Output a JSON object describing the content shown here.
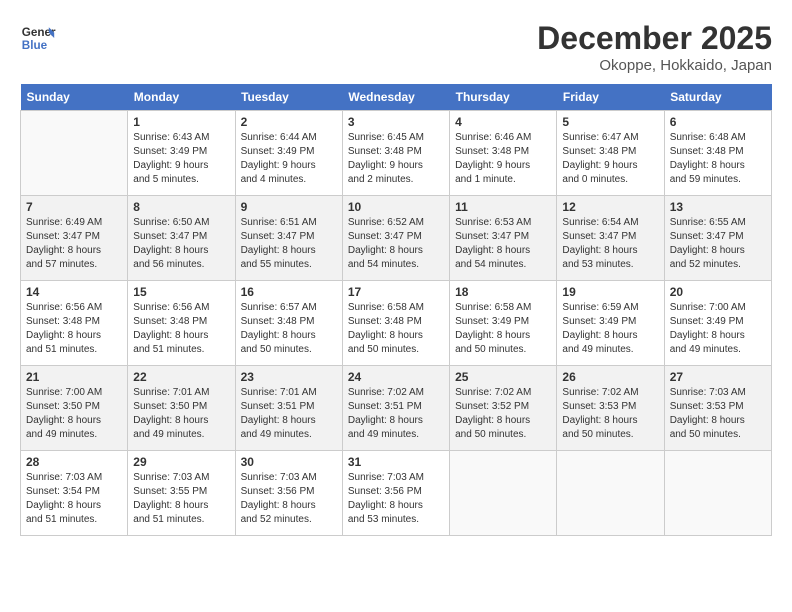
{
  "header": {
    "logo_line1": "General",
    "logo_line2": "Blue",
    "title": "December 2025",
    "subtitle": "Okoppe, Hokkaido, Japan"
  },
  "weekdays": [
    "Sunday",
    "Monday",
    "Tuesday",
    "Wednesday",
    "Thursday",
    "Friday",
    "Saturday"
  ],
  "weeks": [
    [
      {
        "day": "",
        "info": ""
      },
      {
        "day": "1",
        "info": "Sunrise: 6:43 AM\nSunset: 3:49 PM\nDaylight: 9 hours\nand 5 minutes."
      },
      {
        "day": "2",
        "info": "Sunrise: 6:44 AM\nSunset: 3:49 PM\nDaylight: 9 hours\nand 4 minutes."
      },
      {
        "day": "3",
        "info": "Sunrise: 6:45 AM\nSunset: 3:48 PM\nDaylight: 9 hours\nand 2 minutes."
      },
      {
        "day": "4",
        "info": "Sunrise: 6:46 AM\nSunset: 3:48 PM\nDaylight: 9 hours\nand 1 minute."
      },
      {
        "day": "5",
        "info": "Sunrise: 6:47 AM\nSunset: 3:48 PM\nDaylight: 9 hours\nand 0 minutes."
      },
      {
        "day": "6",
        "info": "Sunrise: 6:48 AM\nSunset: 3:48 PM\nDaylight: 8 hours\nand 59 minutes."
      }
    ],
    [
      {
        "day": "7",
        "info": "Sunrise: 6:49 AM\nSunset: 3:47 PM\nDaylight: 8 hours\nand 57 minutes."
      },
      {
        "day": "8",
        "info": "Sunrise: 6:50 AM\nSunset: 3:47 PM\nDaylight: 8 hours\nand 56 minutes."
      },
      {
        "day": "9",
        "info": "Sunrise: 6:51 AM\nSunset: 3:47 PM\nDaylight: 8 hours\nand 55 minutes."
      },
      {
        "day": "10",
        "info": "Sunrise: 6:52 AM\nSunset: 3:47 PM\nDaylight: 8 hours\nand 54 minutes."
      },
      {
        "day": "11",
        "info": "Sunrise: 6:53 AM\nSunset: 3:47 PM\nDaylight: 8 hours\nand 54 minutes."
      },
      {
        "day": "12",
        "info": "Sunrise: 6:54 AM\nSunset: 3:47 PM\nDaylight: 8 hours\nand 53 minutes."
      },
      {
        "day": "13",
        "info": "Sunrise: 6:55 AM\nSunset: 3:47 PM\nDaylight: 8 hours\nand 52 minutes."
      }
    ],
    [
      {
        "day": "14",
        "info": "Sunrise: 6:56 AM\nSunset: 3:48 PM\nDaylight: 8 hours\nand 51 minutes."
      },
      {
        "day": "15",
        "info": "Sunrise: 6:56 AM\nSunset: 3:48 PM\nDaylight: 8 hours\nand 51 minutes."
      },
      {
        "day": "16",
        "info": "Sunrise: 6:57 AM\nSunset: 3:48 PM\nDaylight: 8 hours\nand 50 minutes."
      },
      {
        "day": "17",
        "info": "Sunrise: 6:58 AM\nSunset: 3:48 PM\nDaylight: 8 hours\nand 50 minutes."
      },
      {
        "day": "18",
        "info": "Sunrise: 6:58 AM\nSunset: 3:49 PM\nDaylight: 8 hours\nand 50 minutes."
      },
      {
        "day": "19",
        "info": "Sunrise: 6:59 AM\nSunset: 3:49 PM\nDaylight: 8 hours\nand 49 minutes."
      },
      {
        "day": "20",
        "info": "Sunrise: 7:00 AM\nSunset: 3:49 PM\nDaylight: 8 hours\nand 49 minutes."
      }
    ],
    [
      {
        "day": "21",
        "info": "Sunrise: 7:00 AM\nSunset: 3:50 PM\nDaylight: 8 hours\nand 49 minutes."
      },
      {
        "day": "22",
        "info": "Sunrise: 7:01 AM\nSunset: 3:50 PM\nDaylight: 8 hours\nand 49 minutes."
      },
      {
        "day": "23",
        "info": "Sunrise: 7:01 AM\nSunset: 3:51 PM\nDaylight: 8 hours\nand 49 minutes."
      },
      {
        "day": "24",
        "info": "Sunrise: 7:02 AM\nSunset: 3:51 PM\nDaylight: 8 hours\nand 49 minutes."
      },
      {
        "day": "25",
        "info": "Sunrise: 7:02 AM\nSunset: 3:52 PM\nDaylight: 8 hours\nand 50 minutes."
      },
      {
        "day": "26",
        "info": "Sunrise: 7:02 AM\nSunset: 3:53 PM\nDaylight: 8 hours\nand 50 minutes."
      },
      {
        "day": "27",
        "info": "Sunrise: 7:03 AM\nSunset: 3:53 PM\nDaylight: 8 hours\nand 50 minutes."
      }
    ],
    [
      {
        "day": "28",
        "info": "Sunrise: 7:03 AM\nSunset: 3:54 PM\nDaylight: 8 hours\nand 51 minutes."
      },
      {
        "day": "29",
        "info": "Sunrise: 7:03 AM\nSunset: 3:55 PM\nDaylight: 8 hours\nand 51 minutes."
      },
      {
        "day": "30",
        "info": "Sunrise: 7:03 AM\nSunset: 3:56 PM\nDaylight: 8 hours\nand 52 minutes."
      },
      {
        "day": "31",
        "info": "Sunrise: 7:03 AM\nSunset: 3:56 PM\nDaylight: 8 hours\nand 53 minutes."
      },
      {
        "day": "",
        "info": ""
      },
      {
        "day": "",
        "info": ""
      },
      {
        "day": "",
        "info": ""
      }
    ]
  ]
}
